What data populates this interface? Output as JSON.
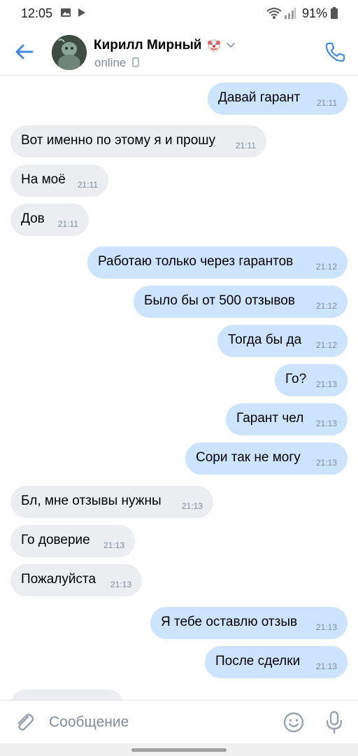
{
  "status_bar": {
    "time": "12:05",
    "battery": "91%",
    "icons": [
      "gallery-icon",
      "play-icon",
      "wifi-icon",
      "signal-icon",
      "battery-icon"
    ]
  },
  "header": {
    "contact_name": "Кирилл Мирный",
    "status": "online",
    "icons": [
      "back-arrow-icon",
      "avatar",
      "clown-emoji-icon",
      "chevron-down-icon",
      "mobile-device-icon",
      "phone-icon"
    ],
    "accent_color": "#3f8ae0"
  },
  "messages": [
    {
      "direction": "out",
      "text": "Давай гарант",
      "time": "21:11"
    },
    {
      "direction": "in",
      "text": "Вот именно по этому я и прошу",
      "time": "21:11"
    },
    {
      "direction": "in",
      "text": "На моё",
      "time": "21:11"
    },
    {
      "direction": "in",
      "text": "Дов",
      "time": "21:11"
    },
    {
      "direction": "out",
      "text": "Работаю только через гарантов",
      "time": "21:12"
    },
    {
      "direction": "out",
      "text": "Было бы от 500 отзывов",
      "time": "21:12"
    },
    {
      "direction": "out",
      "text": "Тогда бы да",
      "time": "21:12"
    },
    {
      "direction": "out",
      "text": "Го?",
      "time": "21:13"
    },
    {
      "direction": "out",
      "text": "Гарант чел",
      "time": "21:13"
    },
    {
      "direction": "out",
      "text": "Сори так не могу",
      "time": "21:13"
    },
    {
      "direction": "in",
      "text": "Бл, мне отзывы нужны",
      "time": "21:13"
    },
    {
      "direction": "in",
      "text": "Го доверие",
      "time": "21:13"
    },
    {
      "direction": "in",
      "text": "Пожалуйста",
      "time": "21:13"
    },
    {
      "direction": "out",
      "text": "Я тебе оставлю отзыв",
      "time": "21:13"
    },
    {
      "direction": "out",
      "text": "После сделки",
      "time": "21:13"
    }
  ],
  "input_bar": {
    "placeholder": "Сообщение",
    "icons": [
      "paperclip-icon",
      "emoji-icon",
      "microphone-icon"
    ]
  },
  "colors": {
    "incoming_bubble": "#ebedf0",
    "outgoing_bubble": "#cce4ff",
    "secondary_text": "#818c99"
  }
}
